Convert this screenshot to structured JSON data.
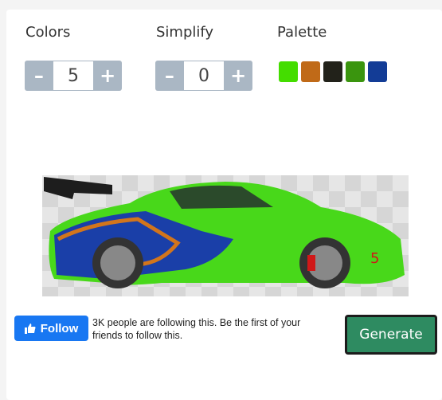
{
  "colors": {
    "label": "Colors",
    "value": "5",
    "minus": "–",
    "plus": "+"
  },
  "simplify": {
    "label": "Simplify",
    "value": "0",
    "minus": "–",
    "plus": "+"
  },
  "palette": {
    "label": "Palette",
    "swatches": [
      "#44dd00",
      "#c06a18",
      "#22221a",
      "#3a950e",
      "#133c96"
    ]
  },
  "image": {
    "icon": "car-image"
  },
  "social": {
    "follow_label": "Follow",
    "follow_text": "3K people are following this. Be the first of your friends to follow this.",
    "icon": "thumbs-up-icon"
  },
  "generate_label": "Generate"
}
